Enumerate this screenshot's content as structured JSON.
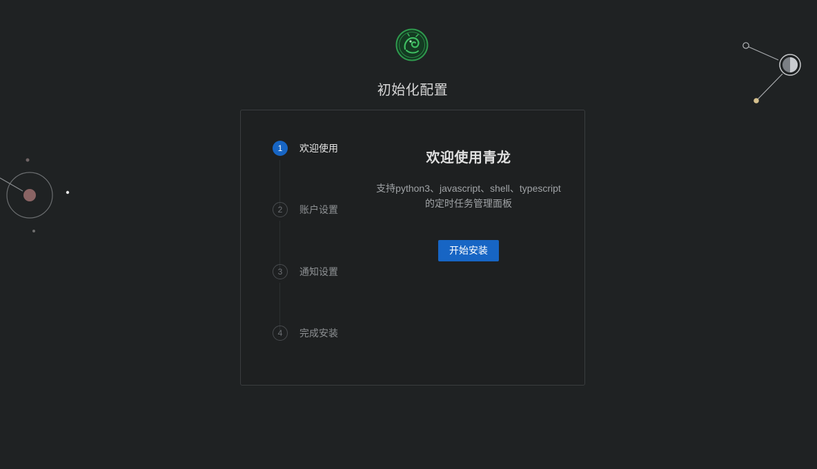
{
  "header": {
    "title": "初始化配置",
    "logo_icon": "qinglong-dragon-logo"
  },
  "steps": [
    {
      "number": "1",
      "label": "欢迎使用",
      "status": "active"
    },
    {
      "number": "2",
      "label": "账户设置",
      "status": "wait"
    },
    {
      "number": "3",
      "label": "通知设置",
      "status": "wait"
    },
    {
      "number": "4",
      "label": "完成安装",
      "status": "wait"
    }
  ],
  "content": {
    "title": "欢迎使用青龙",
    "description_line1": "支持python3、javascript、shell、typescript",
    "description_line2": "的定时任务管理面板",
    "start_button": "开始安装"
  },
  "colors": {
    "background": "#1f2223",
    "accent": "#1765c4",
    "logo_green": "#2f9a4e"
  }
}
